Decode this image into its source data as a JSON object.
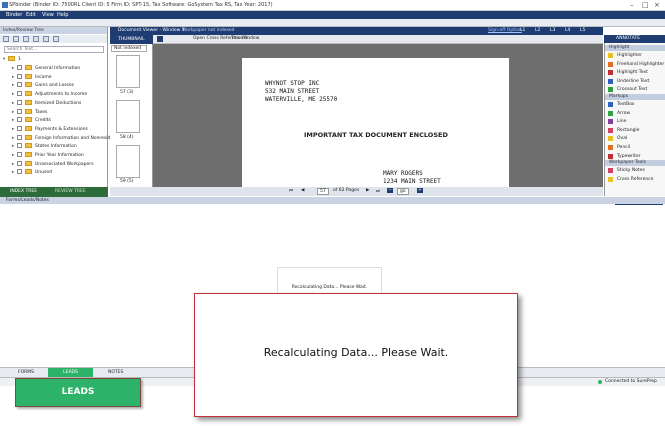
{
  "titlebar": {
    "title": "SPbinder (Binder ID: 7500RL Client ID: 5 Firm ID: SPT-15, Tax Software: GoSystem Tax RS, Tax Year: 2017)"
  },
  "menu": [
    "Binder",
    "Edit",
    "View",
    "Help"
  ],
  "left_pane": {
    "title": "Index/Review Tree",
    "search_placeholder": "Search Text...",
    "root_label": "1",
    "items": [
      "General Information",
      "Income",
      "Gains and Losses",
      "Adjustments to Income",
      "Itemized Deductions",
      "Taxes",
      "Credits",
      "Payments & Extensions",
      "Foreign Information and Nonresident",
      "States Information",
      "Prior Year Information",
      "Unassociated Workpapers",
      "Unused"
    ],
    "tabs": [
      "INDEX TREE",
      "REVIEW TREE"
    ]
  },
  "doc_bar": {
    "title": "Document Viewer - Window 1",
    "subtitle": "Workpaper not indexed",
    "signoff": "Sign-off Option",
    "levels": [
      "L1",
      "L2",
      "L3",
      "L4",
      "L5"
    ]
  },
  "thumb_pane": {
    "tab": "THUMBNAIL",
    "filter": "Not indexed",
    "crossref_label": "Open Cross Reference in:",
    "crossref_value": "This Window",
    "pages": [
      "57 (3)",
      "58 (4)",
      "59 (5)"
    ]
  },
  "document": {
    "sender_lines": [
      "WHYNOT STOP INC",
      "532 MAIN STREET",
      "WATERVILLE, ME 25570"
    ],
    "heading": "IMPORTANT TAX DOCUMENT ENCLOSED",
    "recipient_lines": [
      "MARY ROGERS",
      "1234 MAIN STREET",
      "NEWPORT BEACH, CA 92660"
    ]
  },
  "navbar": {
    "page": "57",
    "of": "of 62 Pages",
    "zoom": "go"
  },
  "right_pane": {
    "title": "ANNOTATE",
    "sections": [
      {
        "title": "Highlight",
        "items": [
          "Highlighter",
          "Freehand Highlighter",
          "Highlight Text",
          "Underline Text",
          "Crossout Text"
        ]
      },
      {
        "title": "Markups",
        "items": [
          "TextBox",
          "Arrow",
          "Line",
          "Rectangle",
          "Oval",
          "Pencil",
          "Typewriter"
        ]
      },
      {
        "title": "Workpaper Tools",
        "items": [
          "Sticky Notes",
          "Cross Reference"
        ]
      }
    ],
    "show_changes": "Show Changes"
  },
  "notes_bar": {
    "title": "Forms/Leads/Notes"
  },
  "bottom_tabs": [
    "FORMS",
    "LEADS",
    "NOTES"
  ],
  "status": {
    "connected": "Connected to SurePrep"
  },
  "leads_button": "LEADS",
  "popup_small": "Recalculating Data... Please Wait.",
  "popup_big": "Recalculating Data... Please Wait.",
  "colors": {
    "navy": "#1f3c73",
    "green": "#2db26a",
    "popup_border": "#c0303a"
  }
}
